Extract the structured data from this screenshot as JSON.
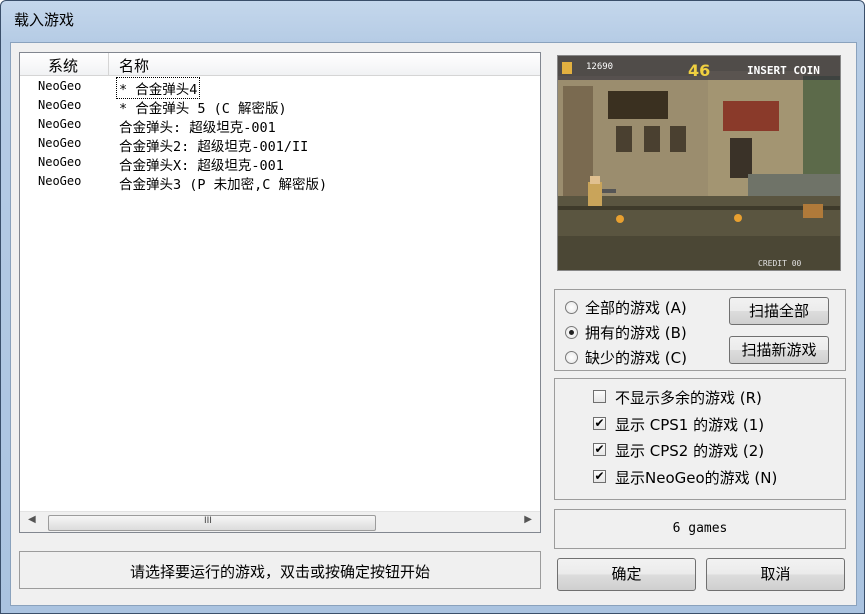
{
  "window": {
    "title": "载入游戏"
  },
  "list": {
    "columns": [
      "系统",
      "名称"
    ],
    "rows": [
      {
        "system": "NeoGeo",
        "name": "* 合金弹头4"
      },
      {
        "system": "NeoGeo",
        "name": "* 合金弹头 5 (C 解密版)"
      },
      {
        "system": "NeoGeo",
        "name": "合金弹头: 超级坦克-001"
      },
      {
        "system": "NeoGeo",
        "name": "合金弹头2: 超级坦克-001/II"
      },
      {
        "system": "NeoGeo",
        "name": "合金弹头X: 超级坦克-001"
      },
      {
        "system": "NeoGeo",
        "name": "合金弹头3 (P 未加密,C 解密版)"
      }
    ],
    "scroll_grip": "III"
  },
  "preview": {
    "hud_score": "12690",
    "hud_time": "46",
    "hud_insert": "INSERT COIN",
    "hud_credit": "CREDIT  00"
  },
  "filter": {
    "options": [
      "全部的游戏 (A)",
      "拥有的游戏 (B)",
      "缺少的游戏 (C)"
    ],
    "selected_index": 1
  },
  "buttons": {
    "scan_all": "扫描全部",
    "scan_new": "扫描新游戏",
    "ok": "确定",
    "cancel": "取消"
  },
  "options": [
    {
      "label": "不显示多余的游戏 (R)",
      "checked": false
    },
    {
      "label": "显示 CPS1 的游戏 (1)",
      "checked": true
    },
    {
      "label": "显示 CPS2 的游戏 (2)",
      "checked": true
    },
    {
      "label": "显示NeoGeo的游戏 (N)",
      "checked": true
    }
  ],
  "games_count": "6 games",
  "status_text": "请选择要运行的游戏，双击或按确定按钮开始",
  "check_mark": "✔"
}
